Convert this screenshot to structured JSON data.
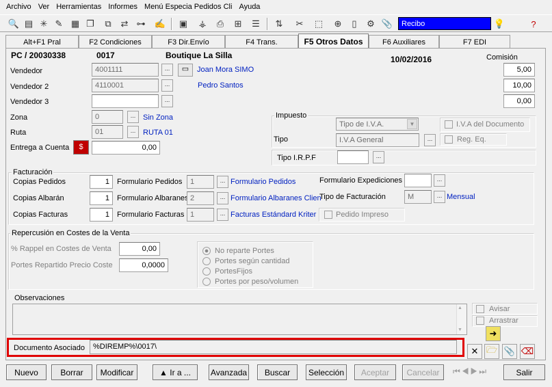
{
  "menu": [
    "Archivo",
    "Ver",
    "Herramientas",
    "Informes",
    "Menú Especia Pedidos Cli",
    "Ayuda"
  ],
  "toolbar": {
    "document_type": "Recibo"
  },
  "tabs": [
    "Alt+F1 Pral",
    "F2 Condiciones",
    "F3 Dir.Envío",
    "F4 Trans.",
    "F5 Otros Datos",
    "F6 Auxiliares",
    "F7 EDI"
  ],
  "header": {
    "doc": "PC / 20030338",
    "code": "0017",
    "client": "Boutique La Silla",
    "date": "10/02/2016",
    "comision_label": "Comisión"
  },
  "vendedor": {
    "label": "Vendedor",
    "code": "4001111",
    "name": "Joan Mora SIMO",
    "comision": "5,00"
  },
  "vendedor2": {
    "label": "Vendedor 2",
    "code": "4110001",
    "name": "Pedro Santos",
    "comision": "10,00"
  },
  "vendedor3": {
    "label": "Vendedor 3",
    "code": "",
    "comision": "0,00"
  },
  "zona": {
    "label": "Zona",
    "value": "0",
    "name": "Sin Zona"
  },
  "ruta": {
    "label": "Ruta",
    "value": "01",
    "name": "RUTA 01"
  },
  "entrega": {
    "label": "Entrega a Cuenta",
    "value": "0,00"
  },
  "impuesto": {
    "title": "Impuesto",
    "tipo_iva": "Tipo de I.V.A.",
    "iva_doc": "I.V.A del Documento",
    "tipo_label": "Tipo",
    "tipo_value": "I.V.A General",
    "reg_eq": "Reg. Eq.",
    "irpf_label": "Tipo I.R.P.F"
  },
  "facturacion": {
    "title": "Facturación",
    "copias_pedidos": "Copias Pedidos",
    "copias_pedidos_v": "1",
    "form_pedidos": "Formulario Pedidos",
    "form_pedidos_v": "1",
    "form_pedidos_n": "Formulario Pedidos",
    "copias_albaran": "Copias Albarán",
    "copias_albaran_v": "1",
    "form_albaranes": "Formulario Albaranes",
    "form_albaranes_v": "2",
    "form_albaranes_n": "Formulario Albaranes Clien",
    "copias_facturas": "Copias Facturas",
    "copias_facturas_v": "1",
    "form_facturas": "Formulario Facturas",
    "form_facturas_v": "1",
    "form_facturas_n": "Facturas Estándard Kriter I",
    "form_expediciones": "Formulario Expediciones",
    "tipo_fact": "Tipo de Facturación",
    "tipo_fact_v": "M",
    "tipo_fact_n": "Mensual",
    "pedido_impreso": "Pedido Impreso"
  },
  "costes": {
    "title": "Repercusión en Costes de la Venta",
    "rappel": "% Rappel en Costes de Venta",
    "rappel_v": "0,00",
    "portes": "Portes Repartido Precio Coste",
    "portes_v": "0,0000",
    "options": [
      "No reparte Portes",
      "Portes según cantidad",
      "PortesFijos",
      "Portes por peso/volumen"
    ]
  },
  "observaciones": {
    "title": "Observaciones",
    "avisar": "Avisar",
    "arrastrar": "Arrastrar"
  },
  "documento": {
    "label": "Documento Asociado",
    "value": "%DIREMP%\\0017\\"
  },
  "buttons": {
    "nuevo": "Nuevo",
    "borrar": "Borrar",
    "modificar": "Modificar",
    "ira": "▲ Ir a ...",
    "avanzada": "Avanzada",
    "buscar": "Buscar",
    "seleccion": "Selección",
    "aceptar": "Aceptar",
    "cancelar": "Cancelar",
    "salir": "Salir"
  }
}
